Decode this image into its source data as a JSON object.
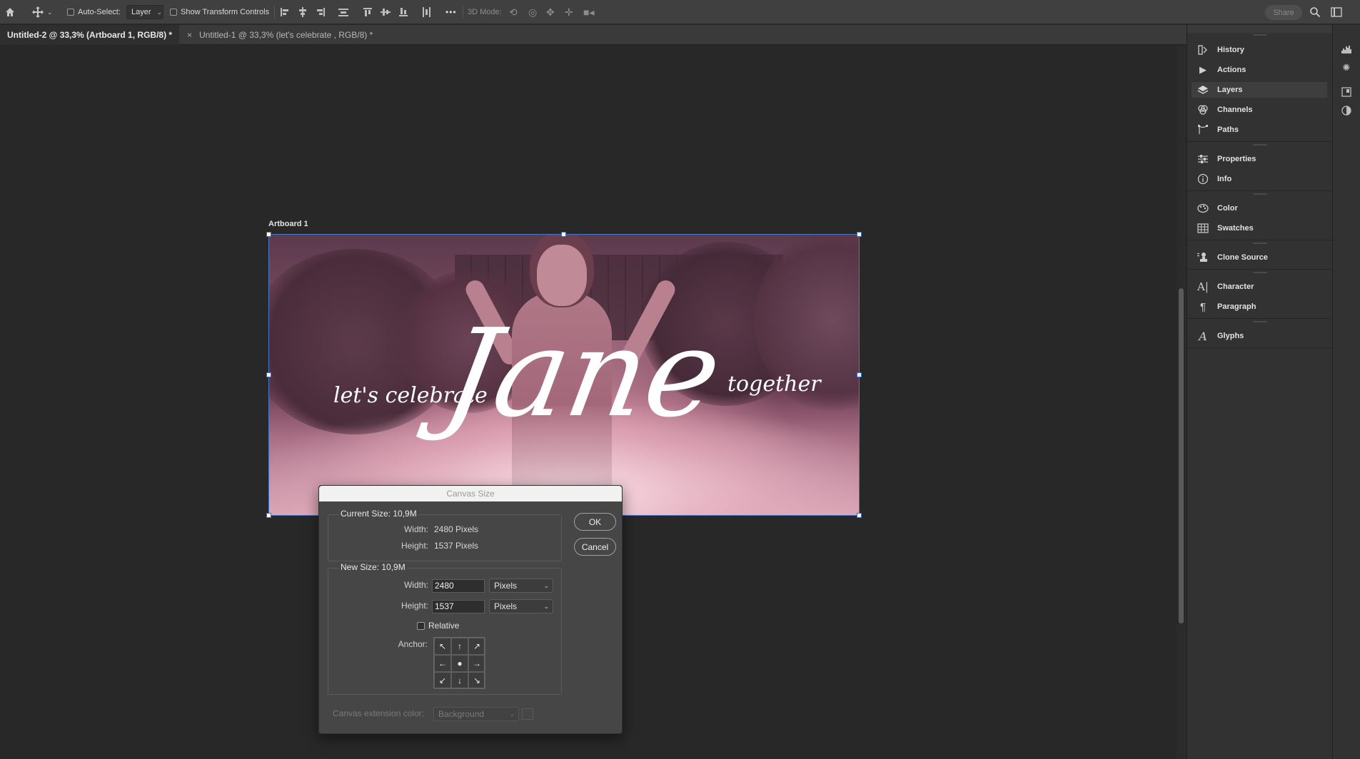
{
  "optionbar": {
    "auto_select_label": "Auto-Select:",
    "auto_select_value": "Layer",
    "show_transform_label": "Show Transform Controls",
    "more_label": "•••",
    "mode_3d_label": "3D Mode:",
    "share_label": "Share"
  },
  "tabs": [
    {
      "label": "Untitled-2 @ 33,3% (Artboard 1, RGB/8) *"
    },
    {
      "close": "×",
      "label": "Untitled-1 @ 33,3% (let's celebrate , RGB/8) *"
    }
  ],
  "artboard": {
    "name": "Artboard 1",
    "text_lets": "let's celebrate",
    "text_jane": "Jane",
    "text_together": "together"
  },
  "dialog": {
    "title": "Canvas Size",
    "current_size_title": "Current Size: 10,9M",
    "width_label": "Width:",
    "height_label": "Height:",
    "current_width": "2480 Pixels",
    "current_height": "1537 Pixels",
    "new_size_title": "New Size: 10,9M",
    "new_width": "2480",
    "new_height": "1537",
    "width_unit": "Pixels",
    "height_unit": "Pixels",
    "relative_label": "Relative",
    "anchor_label": "Anchor:",
    "ext_color_label": "Canvas extension color:",
    "ext_color_value": "Background",
    "ok_label": "OK",
    "cancel_label": "Cancel"
  },
  "panels": [
    {
      "label": "History",
      "icon": "history-icon"
    },
    {
      "label": "Actions",
      "icon": "play-icon"
    },
    {
      "label": "Layers",
      "icon": "layers-icon"
    },
    {
      "label": "Channels",
      "icon": "channels-icon"
    },
    {
      "label": "Paths",
      "icon": "paths-icon"
    },
    {
      "label": "Properties",
      "icon": "sliders-icon"
    },
    {
      "label": "Info",
      "icon": "info-icon"
    },
    {
      "label": "Color",
      "icon": "palette-icon"
    },
    {
      "label": "Swatches",
      "icon": "grid-icon"
    },
    {
      "label": "Clone Source",
      "icon": "clone-stamp-icon"
    },
    {
      "label": "Character",
      "icon": "character-icon"
    },
    {
      "label": "Paragraph",
      "icon": "pilcrow-icon"
    },
    {
      "label": "Glyphs",
      "icon": "glyphs-icon"
    }
  ],
  "selected_panel": "Layers",
  "colors": {
    "workspace": "#282828",
    "panel": "#323232",
    "selection_blue": "#3a6cc4",
    "artboard_tint": "#7b4a60"
  }
}
